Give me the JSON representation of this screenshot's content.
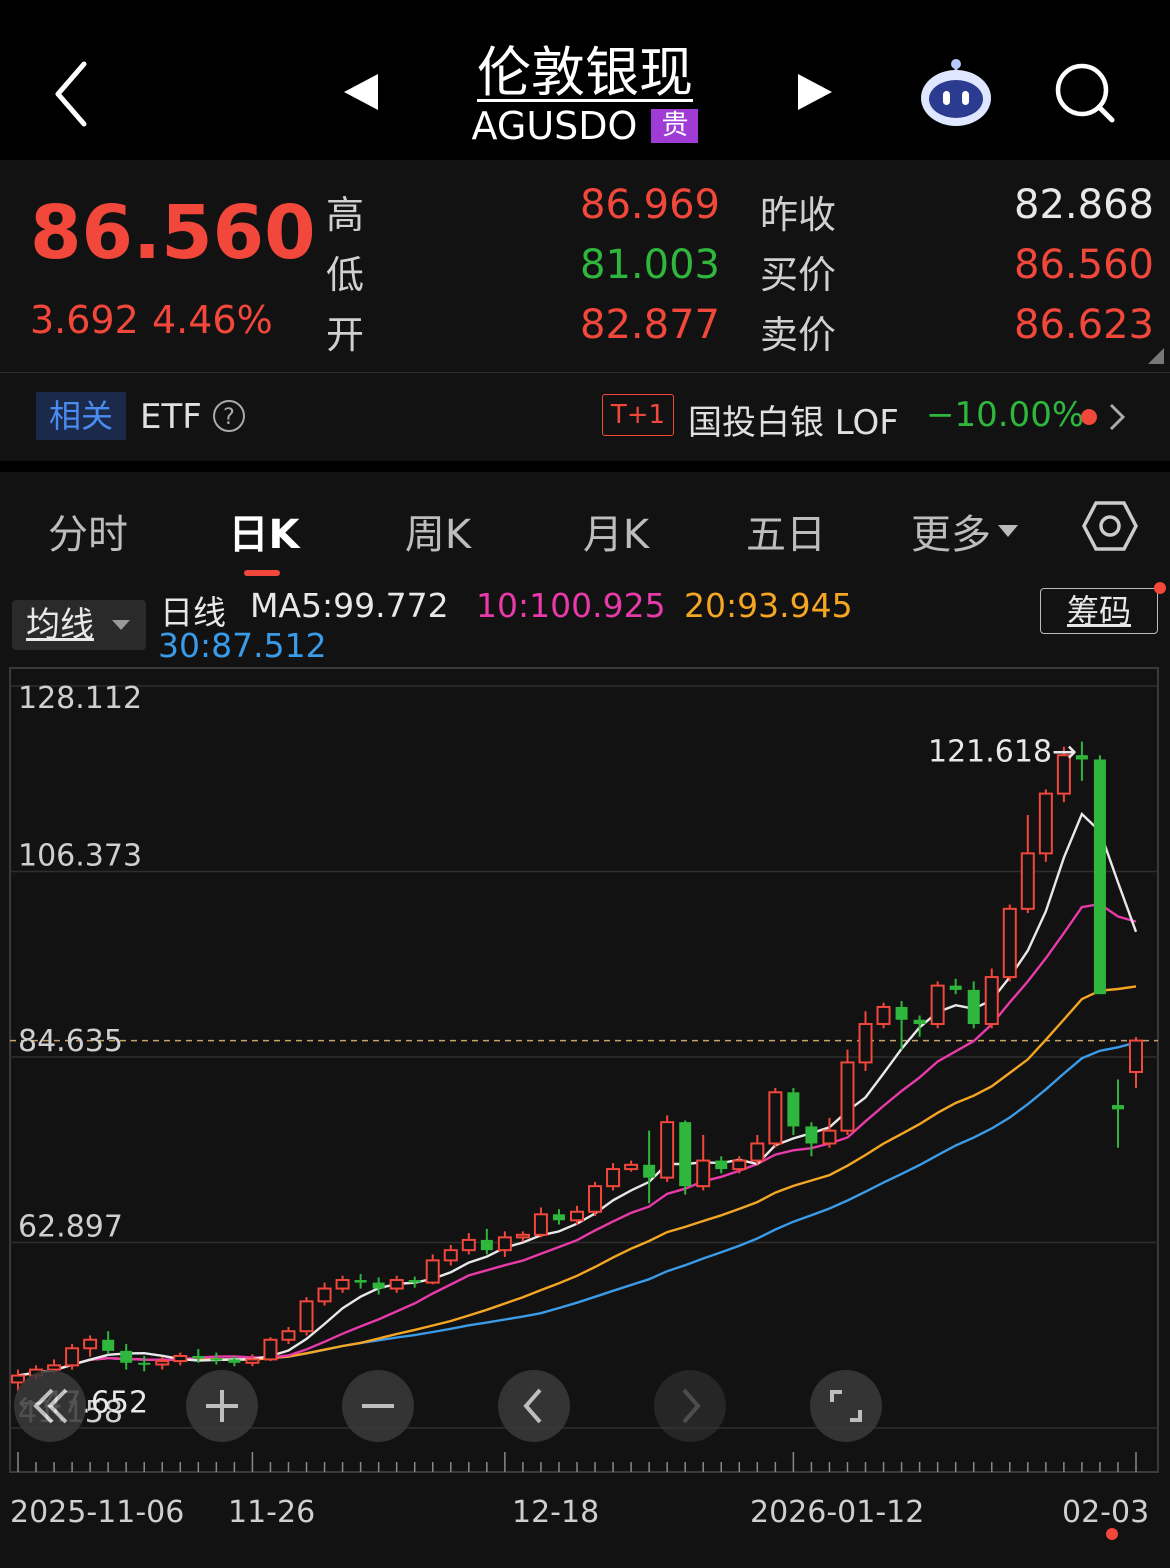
{
  "header": {
    "title": "伦敦银现",
    "code": "AGUSDO",
    "badge": "贵"
  },
  "quote": {
    "price": "86.560",
    "change": "3.692",
    "change_pct": "4.46%",
    "rows": [
      {
        "label": "高",
        "value": "86.969",
        "label2": "昨收",
        "value2": "82.868"
      },
      {
        "label": "低",
        "value": "81.003",
        "label2": "买价",
        "value2": "86.560"
      },
      {
        "label": "开",
        "value": "82.877",
        "label2": "卖价",
        "value2": "86.623"
      }
    ]
  },
  "etf": {
    "tag": "相关",
    "label": "ETF",
    "t1": "T+1",
    "name": "国投白银 LOF",
    "change": "−10.00%"
  },
  "tabs": [
    "分时",
    "日K",
    "周K",
    "月K",
    "五日",
    "更多"
  ],
  "active_tab": "日K",
  "ma": {
    "selector": "均线",
    "prefix": "日线",
    "ma5": "MA5:99.772",
    "ma10": "10:100.925",
    "ma20": "20:93.945",
    "ma30": "30:87.512",
    "chip": "筹码"
  },
  "colors": {
    "up": "#f2473b",
    "down": "#2fb63d",
    "ma5": "#e8e8e8",
    "ma10": "#e83aa8",
    "ma20": "#f5a623",
    "ma30": "#3a9be8"
  },
  "chart_data": {
    "type": "candlestick",
    "y_ticks": [
      "128.112",
      "106.373",
      "84.635",
      "62.897",
      "41.158"
    ],
    "ylim": [
      41.158,
      128.112
    ],
    "x_ticks": [
      "2025-11-06",
      "11-26",
      "12-18",
      "2026-01-12",
      "02-03"
    ],
    "max_label": "121.618→",
    "min_label": "←47.652",
    "current_price_line": 86.56,
    "candles": [
      [
        46.5,
        47.3,
        45.5,
        48.0
      ],
      [
        47.3,
        48.0,
        46.8,
        48.5
      ],
      [
        48.0,
        48.5,
        47.5,
        49.2
      ],
      [
        48.5,
        50.5,
        48.0,
        51.0
      ],
      [
        50.5,
        51.5,
        49.5,
        52.0
      ],
      [
        51.5,
        50.2,
        49.8,
        52.5
      ],
      [
        50.2,
        48.8,
        48.0,
        51.0
      ],
      [
        48.8,
        48.6,
        47.8,
        49.6
      ],
      [
        48.6,
        49.0,
        48.0,
        49.5
      ],
      [
        49.0,
        49.6,
        48.5,
        50.0
      ],
      [
        49.6,
        49.3,
        48.8,
        50.4
      ],
      [
        49.3,
        49.2,
        48.6,
        50.0
      ],
      [
        49.2,
        48.8,
        48.4,
        49.6
      ],
      [
        48.8,
        49.2,
        48.4,
        49.8
      ],
      [
        49.2,
        51.5,
        49.0,
        51.8
      ],
      [
        51.5,
        52.5,
        51.0,
        53.0
      ],
      [
        52.5,
        56.0,
        52.0,
        56.5
      ],
      [
        56.0,
        57.5,
        55.5,
        58.2
      ],
      [
        57.5,
        58.5,
        57.0,
        59.0
      ],
      [
        58.5,
        58.2,
        57.5,
        59.2
      ],
      [
        58.2,
        57.5,
        56.8,
        58.8
      ],
      [
        57.5,
        58.5,
        57.0,
        59.0
      ],
      [
        58.5,
        58.2,
        57.6,
        58.9
      ],
      [
        58.2,
        60.8,
        58.0,
        61.5
      ],
      [
        60.8,
        62.0,
        60.2,
        62.6
      ],
      [
        62.0,
        63.2,
        61.5,
        64.0
      ],
      [
        63.2,
        62.0,
        61.5,
        64.5
      ],
      [
        62.0,
        63.5,
        61.2,
        64.2
      ],
      [
        63.5,
        63.8,
        63.0,
        64.2
      ],
      [
        63.8,
        66.2,
        63.5,
        67.0
      ],
      [
        66.2,
        65.5,
        65.0,
        66.8
      ],
      [
        65.5,
        66.5,
        65.0,
        67.2
      ],
      [
        66.5,
        69.5,
        66.0,
        70.0
      ],
      [
        69.5,
        71.5,
        69.0,
        72.2
      ],
      [
        71.5,
        72.0,
        71.2,
        72.5
      ],
      [
        72.0,
        70.5,
        67.5,
        76.0
      ],
      [
        70.5,
        77.0,
        70.0,
        77.8
      ],
      [
        77.0,
        69.5,
        68.5,
        77.2
      ],
      [
        69.5,
        72.5,
        69.0,
        75.5
      ],
      [
        72.5,
        71.5,
        71.0,
        73.0
      ],
      [
        71.5,
        72.5,
        71.0,
        73.0
      ],
      [
        72.5,
        74.5,
        72.0,
        75.5
      ],
      [
        74.5,
        80.5,
        74.0,
        81.0
      ],
      [
        80.5,
        76.5,
        75.5,
        81.0
      ],
      [
        76.5,
        74.5,
        73.0,
        77.0
      ],
      [
        74.5,
        76.0,
        74.0,
        77.5
      ],
      [
        76.0,
        84.0,
        75.5,
        85.5
      ],
      [
        84.0,
        88.5,
        83.0,
        90.0
      ],
      [
        88.5,
        90.5,
        88.0,
        91.0
      ],
      [
        90.5,
        89.0,
        85.5,
        91.2
      ],
      [
        89.0,
        88.5,
        87.0,
        89.5
      ],
      [
        88.5,
        93.0,
        88.0,
        93.5
      ],
      [
        93.0,
        92.5,
        92.0,
        93.8
      ],
      [
        92.5,
        88.5,
        88.0,
        93.5
      ],
      [
        88.5,
        94.0,
        88.0,
        95.0
      ],
      [
        94.0,
        102.0,
        93.5,
        102.5
      ],
      [
        102.0,
        108.5,
        101.5,
        113.0
      ],
      [
        108.5,
        115.5,
        107.5,
        116.0
      ],
      [
        115.5,
        120.0,
        114.5,
        121.0
      ],
      [
        120.0,
        119.5,
        117.0,
        121.6
      ],
      [
        119.5,
        92.0,
        92.0,
        120.0
      ],
      [
        79.0,
        78.5,
        74.0,
        82.0
      ],
      [
        82.877,
        86.56,
        81.003,
        86.969
      ]
    ]
  }
}
